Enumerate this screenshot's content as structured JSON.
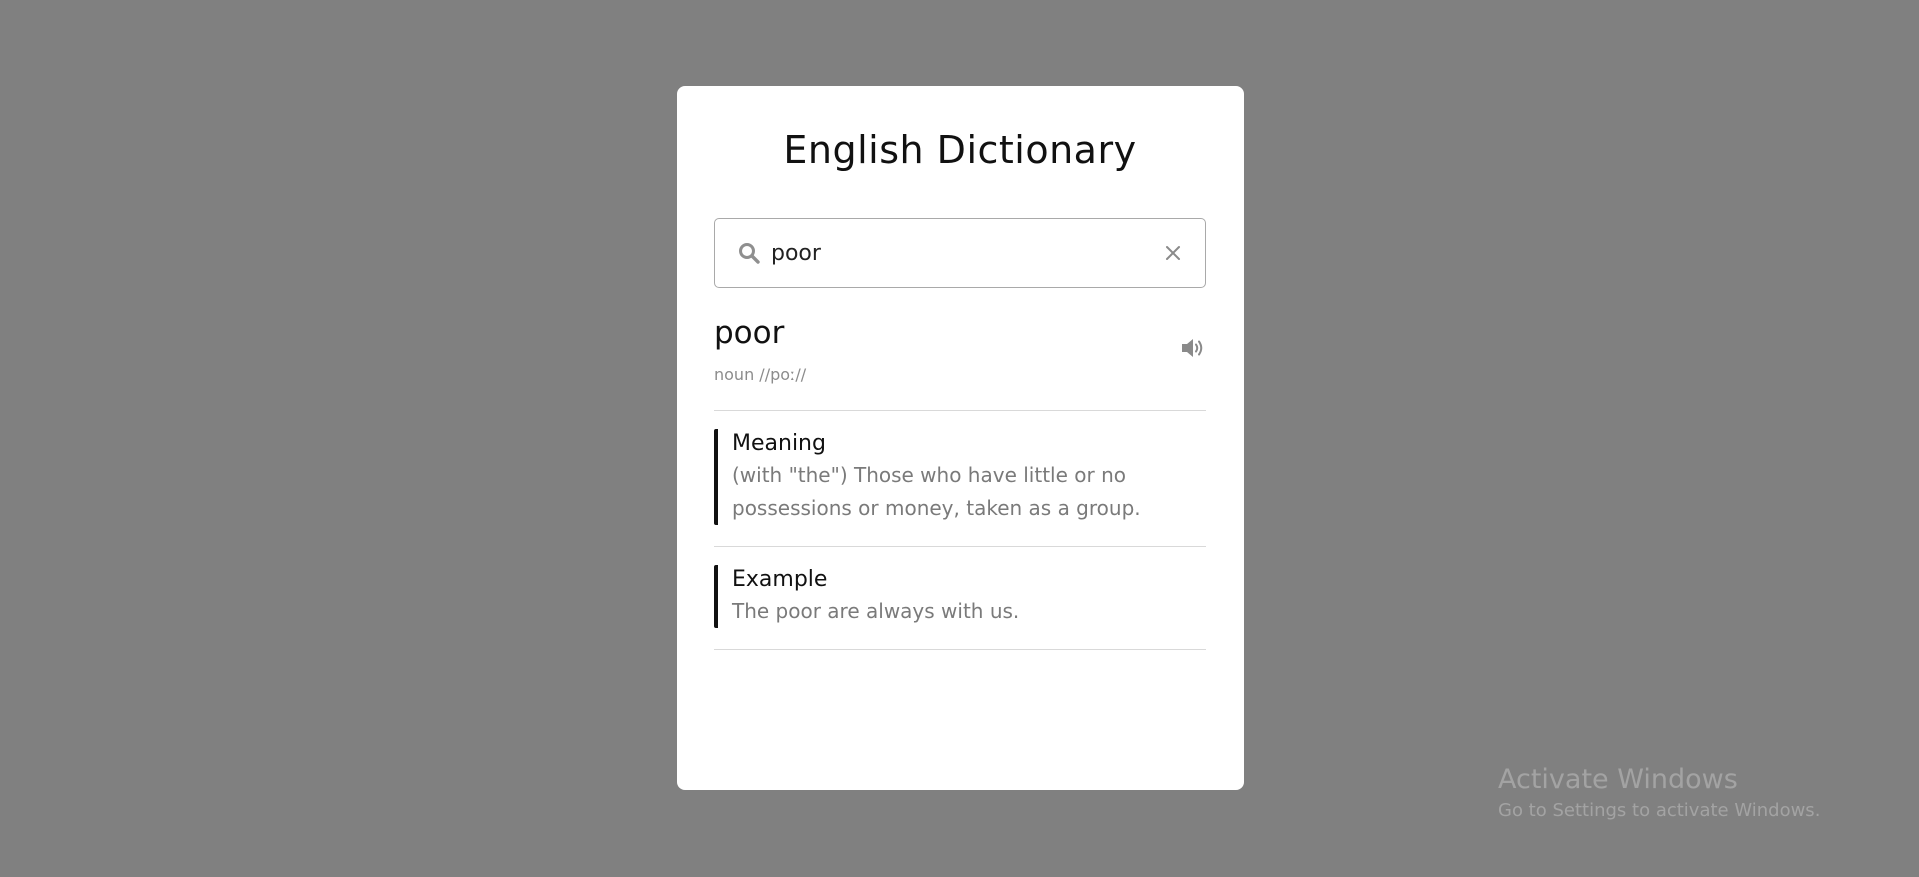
{
  "app": {
    "title": "English Dictionary"
  },
  "search": {
    "value": "poor",
    "icon": "search-icon",
    "clear_icon": "close-icon"
  },
  "result": {
    "word": "poor",
    "phonetic": "noun //poː//",
    "audio_icon": "speaker-icon"
  },
  "meaning": {
    "heading": "Meaning",
    "text": "(with \"the\") Those who have little or no possessions or money, taken as a group."
  },
  "example": {
    "heading": "Example",
    "text": "The poor are always with us."
  },
  "watermark": {
    "title": "Activate Windows",
    "subtitle": "Go to Settings to activate Windows."
  },
  "colors": {
    "background": "#808080",
    "card": "#ffffff",
    "accent_bar": "#111111",
    "muted_text": "#7a7a7a"
  }
}
